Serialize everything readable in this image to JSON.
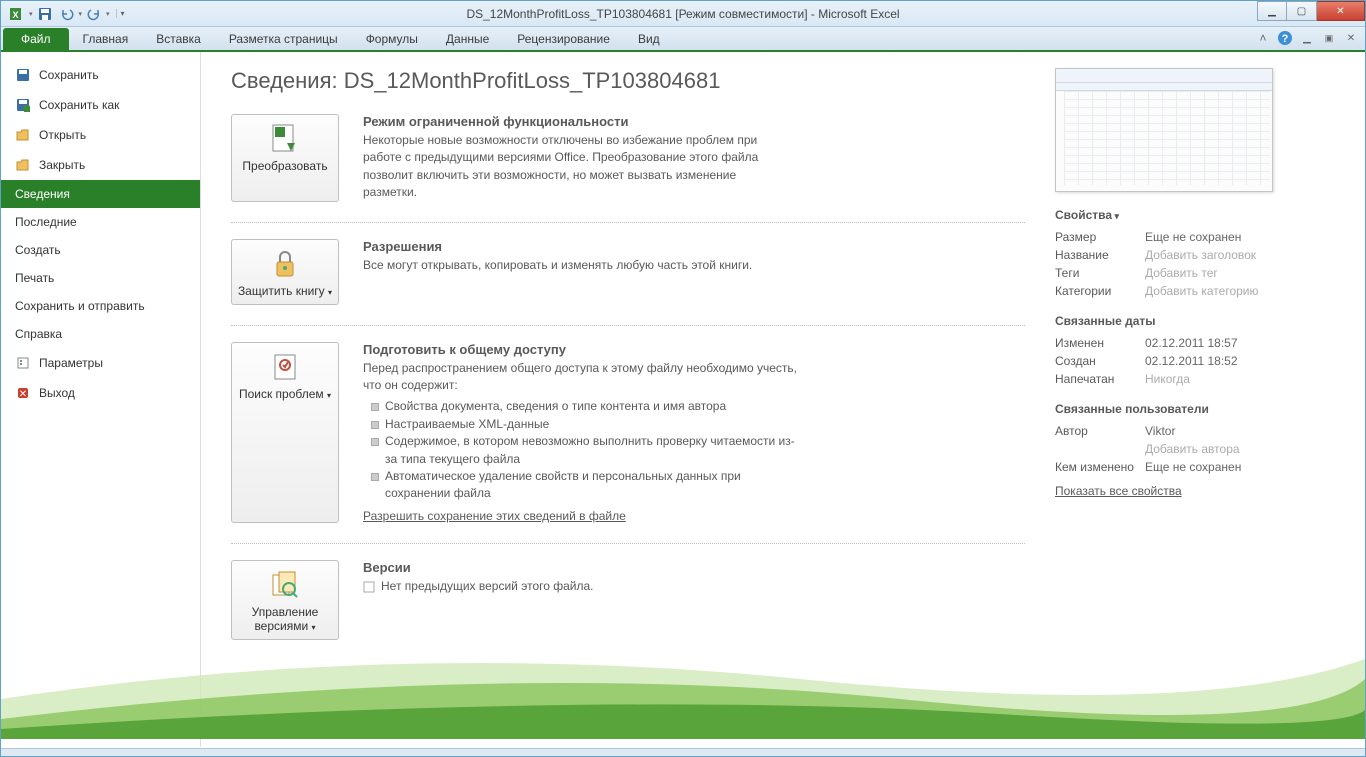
{
  "title": "DS_12MonthProfitLoss_TP103804681  [Режим совместимости]  -  Microsoft Excel",
  "ribbon": {
    "file": "Файл",
    "tabs": [
      "Главная",
      "Вставка",
      "Разметка страницы",
      "Формулы",
      "Данные",
      "Рецензирование",
      "Вид"
    ]
  },
  "sidebar": {
    "save": "Сохранить",
    "saveas": "Сохранить как",
    "open": "Открыть",
    "close": "Закрыть",
    "info": "Сведения",
    "recent": "Последние",
    "new": "Создать",
    "print": "Печать",
    "send": "Сохранить и отправить",
    "help": "Справка",
    "options": "Параметры",
    "exit": "Выход"
  },
  "page": {
    "title": "Сведения: DS_12MonthProfitLoss_TP103804681"
  },
  "sections": {
    "convert": {
      "btn": "Преобразовать",
      "h": "Режим ограниченной функциональности",
      "p": "Некоторые новые возможности отключены во избежание проблем при работе с предыдущими версиями Office. Преобразование этого файла позволит включить эти возможности, но может вызвать изменение разметки."
    },
    "protect": {
      "btn": "Защитить книгу",
      "h": "Разрешения",
      "p": "Все могут открывать, копировать и изменять любую часть этой книги."
    },
    "check": {
      "btn": "Поиск проблем",
      "h": "Подготовить к общему доступу",
      "p": "Перед распространением общего доступа к этому файлу необходимо учесть, что он содержит:",
      "items": [
        "Свойства документа, сведения о типе контента и имя автора",
        "Настраиваемые XML-данные",
        "Содержимое, в котором невозможно выполнить проверку читаемости из-за типа текущего файла",
        "Автоматическое удаление свойств и персональных данных при сохранении файла"
      ],
      "link": "Разрешить сохранение этих сведений в файле"
    },
    "versions": {
      "btn": "Управление версиями",
      "h": "Версии",
      "p": "Нет предыдущих версий этого файла."
    }
  },
  "props": {
    "head1": "Свойства",
    "rows1": [
      {
        "l": "Размер",
        "v": "Еще не сохранен",
        "ph": false
      },
      {
        "l": "Название",
        "v": "Добавить заголовок",
        "ph": true
      },
      {
        "l": "Теги",
        "v": "Добавить тег",
        "ph": true
      },
      {
        "l": "Категории",
        "v": "Добавить категорию",
        "ph": true
      }
    ],
    "head2": "Связанные даты",
    "rows2": [
      {
        "l": "Изменен",
        "v": "02.12.2011 18:57",
        "ph": false
      },
      {
        "l": "Создан",
        "v": "02.12.2011 18:52",
        "ph": false
      },
      {
        "l": "Напечатан",
        "v": "Никогда",
        "ph": true
      }
    ],
    "head3": "Связанные пользователи",
    "rows3": [
      {
        "l": "Автор",
        "v": "Viktor",
        "ph": false
      },
      {
        "l": "",
        "v": "Добавить автора",
        "ph": true
      },
      {
        "l": "Кем изменено",
        "v": "Еще не сохранен",
        "ph": false
      }
    ],
    "show_all": "Показать все свойства"
  }
}
